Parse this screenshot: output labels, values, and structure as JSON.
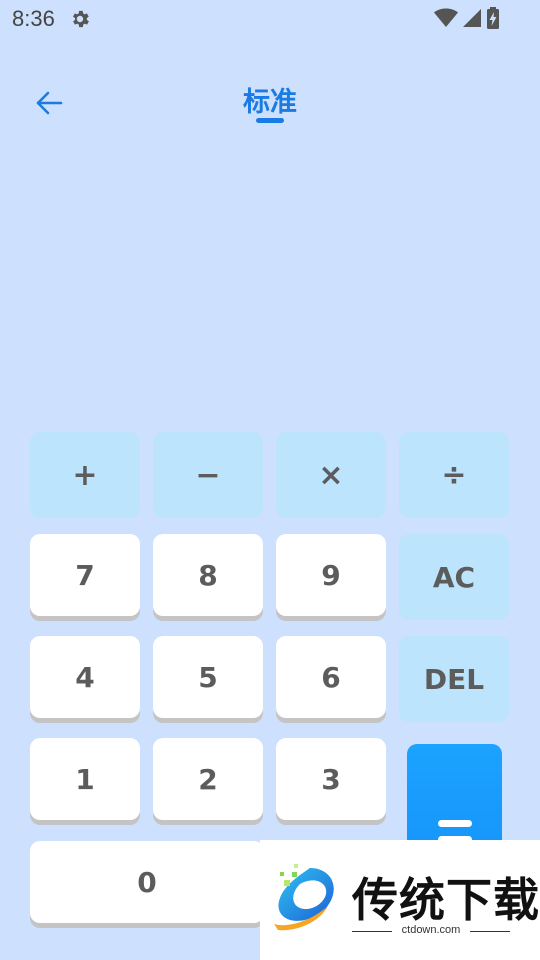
{
  "status_bar": {
    "time": "8:36",
    "icons": [
      "settings-icon",
      "wifi-icon",
      "signal-icon",
      "battery-charging-icon"
    ]
  },
  "header": {
    "back_icon": "arrow-left-icon",
    "title": "标准",
    "accent_color": "#1a7be4"
  },
  "keypad": {
    "plus": "+",
    "minus": "−",
    "times": "×",
    "divide": "÷",
    "seven": "7",
    "eight": "8",
    "nine": "9",
    "clear": "AC",
    "four": "4",
    "five": "5",
    "six": "6",
    "delete": "DEL",
    "one": "1",
    "two": "2",
    "three": "3",
    "zero": "0",
    "equals_icon": "equals-icon"
  },
  "watermark": {
    "brand": "传统下载",
    "url": "ctdown.com"
  },
  "colors": {
    "background": "#cde0fd",
    "operator_key": "#bde4fd",
    "number_key": "#ffffff",
    "equals_key": "#1288f5"
  }
}
